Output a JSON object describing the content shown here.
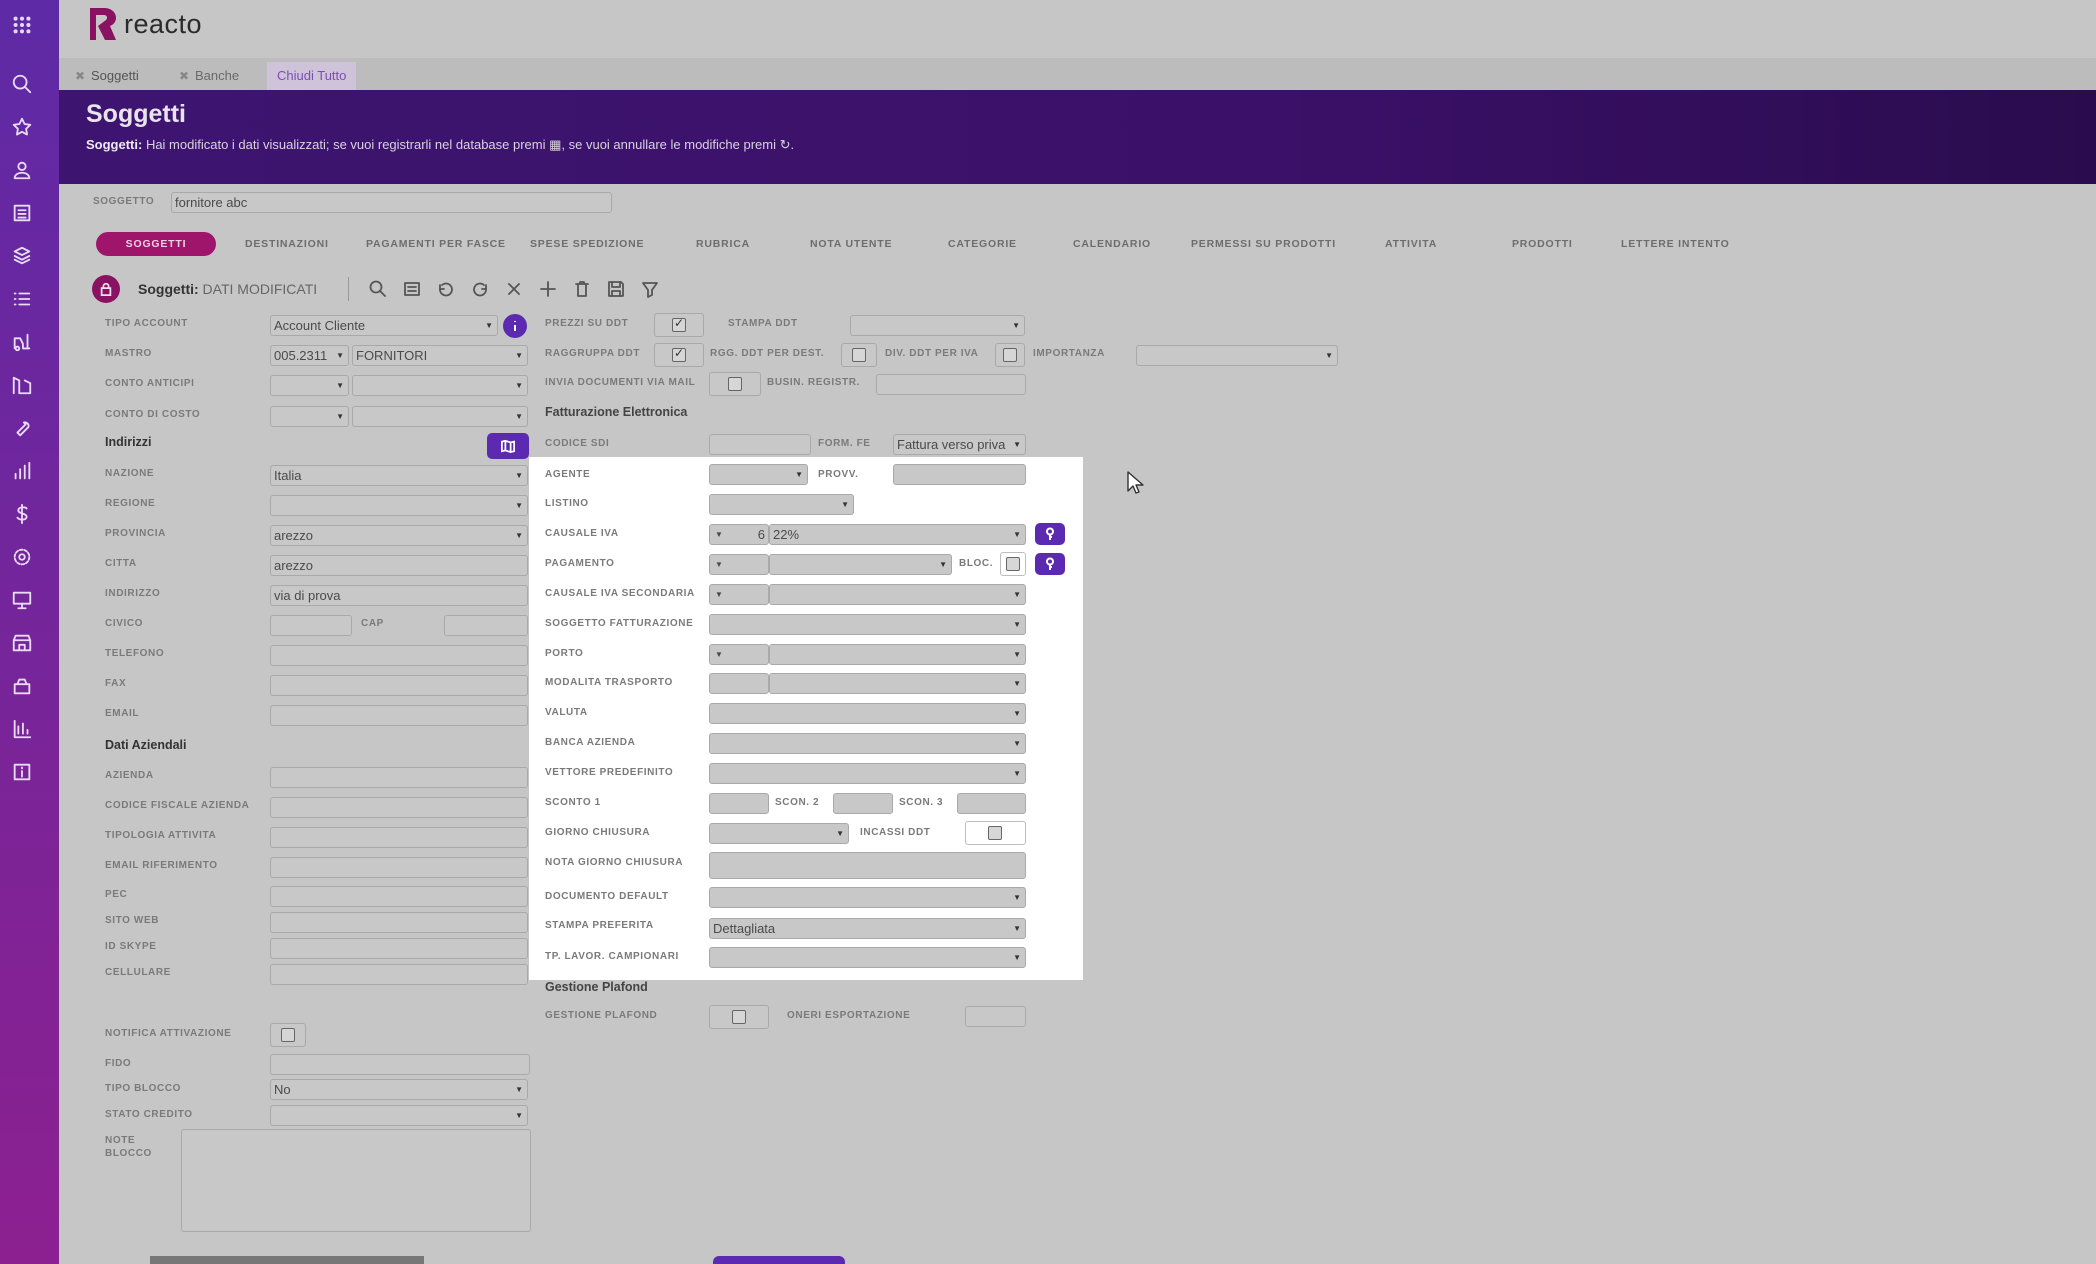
{
  "app": {
    "name": "reacto",
    "brand_color": "#8a1262",
    "accent": "#5c2ab0"
  },
  "sidebar": {
    "icons": [
      "apps-grid-icon",
      "search-icon",
      "star-icon",
      "user-icon",
      "list-document-icon",
      "boxes-icon",
      "list-icon",
      "forklift-icon",
      "warehouse-icon",
      "wrench-icon",
      "chart-bar-icon",
      "dollar-icon",
      "gear-icon",
      "monitor-icon",
      "store-icon",
      "box-icon",
      "chart-columns-icon",
      "info-icon"
    ]
  },
  "tabs": [
    {
      "label": "Soggetti",
      "active": true
    },
    {
      "label": "Banche",
      "active": false
    },
    {
      "label": "Chiudi Tutto"
    }
  ],
  "header": {
    "title": "Soggetti",
    "message_prefix": "Soggetti:",
    "message": " Hai modificato i dati visualizzati; se vuoi registrarli nel database premi ▦, se vuoi annullare le modifiche premi ↻."
  },
  "soggetto": {
    "label": "SOGGETTO",
    "value": "fornitore abc"
  },
  "nav_tabs": [
    "SOGGETTI",
    "DESTINAZIONI",
    "PAGAMENTI PER FASCE",
    "SPESE SPEDIZIONE",
    "RUBRICA",
    "NOTA UTENTE",
    "CATEGORIE",
    "CALENDARIO",
    "PERMESSI SU PRODOTTI",
    "ATTIVITA",
    "PRODOTTI",
    "LETTERE INTENTO"
  ],
  "toolbar": {
    "title_prefix": "Soggetti:",
    "title_status": " DATI MODIFICATI"
  },
  "left": {
    "tipo_account": {
      "label": "TIPO ACCOUNT",
      "value": "Account Cliente"
    },
    "mastro": {
      "label": "MASTRO",
      "code": "005.2311",
      "value": "FORNITORI"
    },
    "conto_anticipi": {
      "label": "CONTO ANTICIPI"
    },
    "conto_di_costo": {
      "label": "CONTO DI COSTO"
    },
    "indirizzi": "Indirizzi",
    "nazione": {
      "label": "NAZIONE",
      "value": "Italia"
    },
    "regione": {
      "label": "REGIONE"
    },
    "provincia": {
      "label": "PROVINCIA",
      "value": "arezzo"
    },
    "citta": {
      "label": "CITTA",
      "value": "arezzo"
    },
    "indirizzo": {
      "label": "INDIRIZZO",
      "value": "via di prova"
    },
    "civico": {
      "label": "CIVICO"
    },
    "cap": {
      "label": "CAP"
    },
    "telefono": {
      "label": "TELEFONO"
    },
    "fax": {
      "label": "FAX"
    },
    "email": {
      "label": "EMAIL"
    },
    "dati_aziendali": "Dati Aziendali",
    "azienda": {
      "label": "AZIENDA"
    },
    "codice_fiscale": {
      "label": "CODICE FISCALE AZIENDA"
    },
    "tipologia": {
      "label": "TIPOLOGIA ATTIVITA"
    },
    "email_rif": {
      "label": "EMAIL RIFERIMENTO"
    },
    "pec": {
      "label": "PEC"
    },
    "sito": {
      "label": "SITO WEB"
    },
    "skype": {
      "label": "ID SKYPE"
    },
    "cellulare": {
      "label": "CELLULARE"
    },
    "notifica": {
      "label": "NOTIFICA ATTIVAZIONE"
    },
    "fido": {
      "label": "FIDO"
    },
    "tipo_blocco": {
      "label": "TIPO BLOCCO",
      "value": "No"
    },
    "stato_credito": {
      "label": "STATO CREDITO"
    },
    "note_blocco": {
      "label1": "NOTE",
      "label2": "BLOCCO"
    }
  },
  "right": {
    "prezzi_ddt": {
      "label": "PREZZI SU DDT"
    },
    "stampa_ddt": {
      "label": "STAMPA DDT"
    },
    "raggruppa_ddt": {
      "label": "RAGGRUPPA DDT"
    },
    "rgg_ddt_dest": {
      "label": "RGG. DDT PER DEST."
    },
    "div_ddt_iva": {
      "label": "DIV. DDT PER IVA"
    },
    "importanza": {
      "label": "IMPORTANZA"
    },
    "invia_doc": {
      "label": "INVIA DOCUMENTI VIA MAIL"
    },
    "busin": {
      "label": "BUSIN. REGISTR."
    },
    "fatt_elettronica": "Fatturazione Elettronica",
    "codice_sdi": {
      "label": "CODICE SDI"
    },
    "form_fe": {
      "label": "FORM. FE",
      "value": "Fattura verso priva"
    },
    "agente": {
      "label": "AGENTE"
    },
    "provv": {
      "label": "PROVV."
    },
    "listino": {
      "label": "LISTINO"
    },
    "causale_iva": {
      "label": "CAUSALE IVA",
      "code": "6",
      "value": "22%"
    },
    "pagamento": {
      "label": "PAGAMENTO"
    },
    "bloc": {
      "label": "BLOC."
    },
    "causale_iva_sec": {
      "label": "CAUSALE IVA SECONDARIA"
    },
    "soggetto_fatt": {
      "label": "SOGGETTO FATTURAZIONE"
    },
    "porto": {
      "label": "PORTO"
    },
    "modalita": {
      "label": "MODALITA TRASPORTO"
    },
    "valuta": {
      "label": "VALUTA"
    },
    "banca": {
      "label": "BANCA AZIENDA"
    },
    "vettore": {
      "label": "VETTORE PREDEFINITO"
    },
    "sconto1": {
      "label": "SCONTO 1"
    },
    "scon2": {
      "label": "SCON. 2"
    },
    "scon3": {
      "label": "SCON. 3"
    },
    "giorno_chiusura": {
      "label": "GIORNO CHIUSURA"
    },
    "incassi_ddt": {
      "label": "INCASSI DDT"
    },
    "nota_giorno": {
      "label": "NOTA GIORNO CHIUSURA"
    },
    "doc_default": {
      "label": "DOCUMENTO DEFAULT"
    },
    "stampa_pref": {
      "label": "STAMPA PREFERITA",
      "value": "Dettagliata"
    },
    "tp_lavor": {
      "label": "TP. LAVOR. CAMPIONARI"
    },
    "gestione_plafond_sec": "Gestione Plafond",
    "gestione_plafond": {
      "label": "GESTIONE PLAFOND"
    },
    "oneri": {
      "label": "ONERI ESPORTAZIONE"
    }
  }
}
